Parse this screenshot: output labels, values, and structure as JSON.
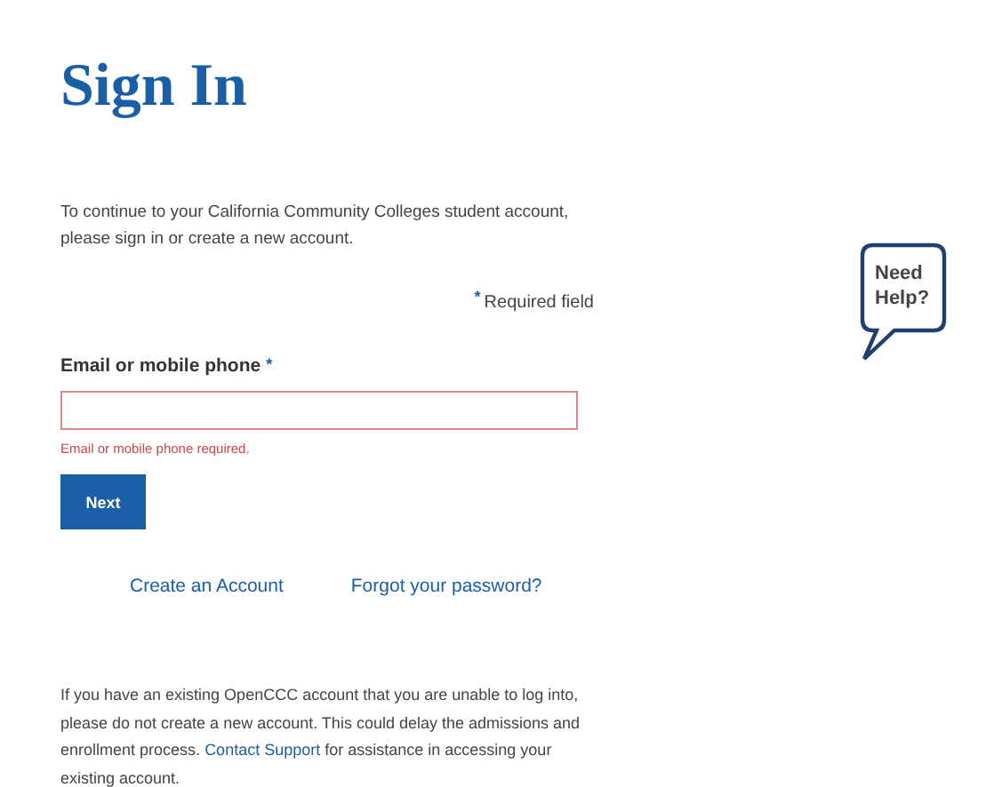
{
  "title": "Sign In",
  "intro": "To continue to your California Community Colleges student account, please sign in or create a new account.",
  "required_note": {
    "marker": "*",
    "text": "Required field"
  },
  "email_field": {
    "label": "Email or mobile phone",
    "marker": "*",
    "error": "Email or mobile phone required.",
    "invalid": true
  },
  "next_button": "Next",
  "links": [
    "Create an Account",
    "Forgot your password?"
  ],
  "notice": {
    "before": "If you have an existing OpenCCC account that you are unable to log into, please do not create a new account. This could delay the admissions and enrollment process.",
    "link": "Contact Support",
    "after": "for assistance in accessing your existing account."
  },
  "help_bubble": "Need Help?"
}
